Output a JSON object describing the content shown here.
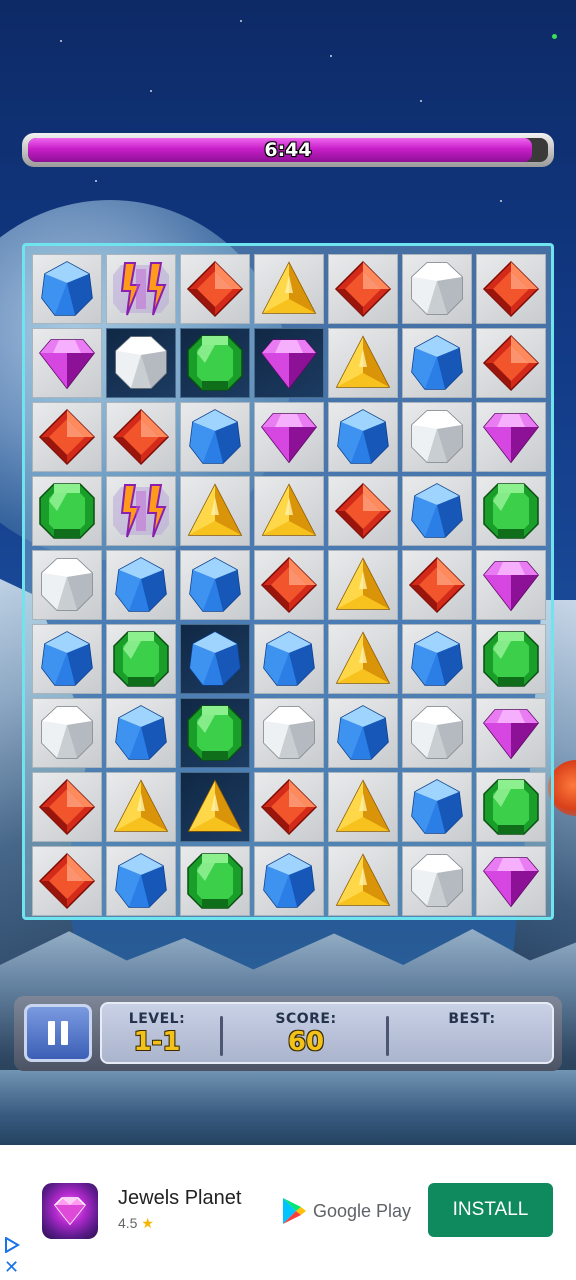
{
  "timer": {
    "text": "6:44",
    "progress": 0.97
  },
  "board": {
    "rows": 9,
    "cols": 7,
    "cells": [
      [
        "blue",
        "bolt",
        "red",
        "yellow",
        "red",
        "white",
        "red"
      ],
      [
        "purple",
        "white",
        "green",
        "purple",
        "yellow",
        "blue",
        "red"
      ],
      [
        "red",
        "red",
        "blue",
        "purple",
        "blue",
        "white",
        "purple"
      ],
      [
        "green",
        "bolt",
        "yellow",
        "yellow",
        "red",
        "blue",
        "green"
      ],
      [
        "white",
        "blue",
        "blue",
        "red",
        "yellow",
        "red",
        "purple"
      ],
      [
        "blue",
        "green",
        "blue",
        "blue",
        "yellow",
        "blue",
        "green"
      ],
      [
        "white",
        "blue",
        "green",
        "white",
        "blue",
        "white",
        "purple"
      ],
      [
        "red",
        "yellow",
        "yellow",
        "red",
        "yellow",
        "blue",
        "green"
      ],
      [
        "red",
        "blue",
        "green",
        "blue",
        "yellow",
        "white",
        "purple"
      ]
    ],
    "dark_tiles": [
      [
        1,
        1
      ],
      [
        1,
        2
      ],
      [
        1,
        3
      ],
      [
        5,
        2
      ],
      [
        6,
        2
      ],
      [
        7,
        2
      ]
    ]
  },
  "status": {
    "pause_icon": "pause-icon",
    "level_label": "LEVEL:",
    "level_value": "1-1",
    "score_label": "SCORE:",
    "score_value": "60",
    "best_label": "BEST:",
    "best_value": ""
  },
  "ad": {
    "app_name": "Jewels Planet",
    "rating": "4.5",
    "store_name": "Google Play",
    "install_label": "INSTALL"
  },
  "colors": {
    "timer_fill": "#c81fc9",
    "board_border": "#6fe3ee",
    "install_button": "#0f8a5f",
    "score_text": "#f2c21a"
  }
}
